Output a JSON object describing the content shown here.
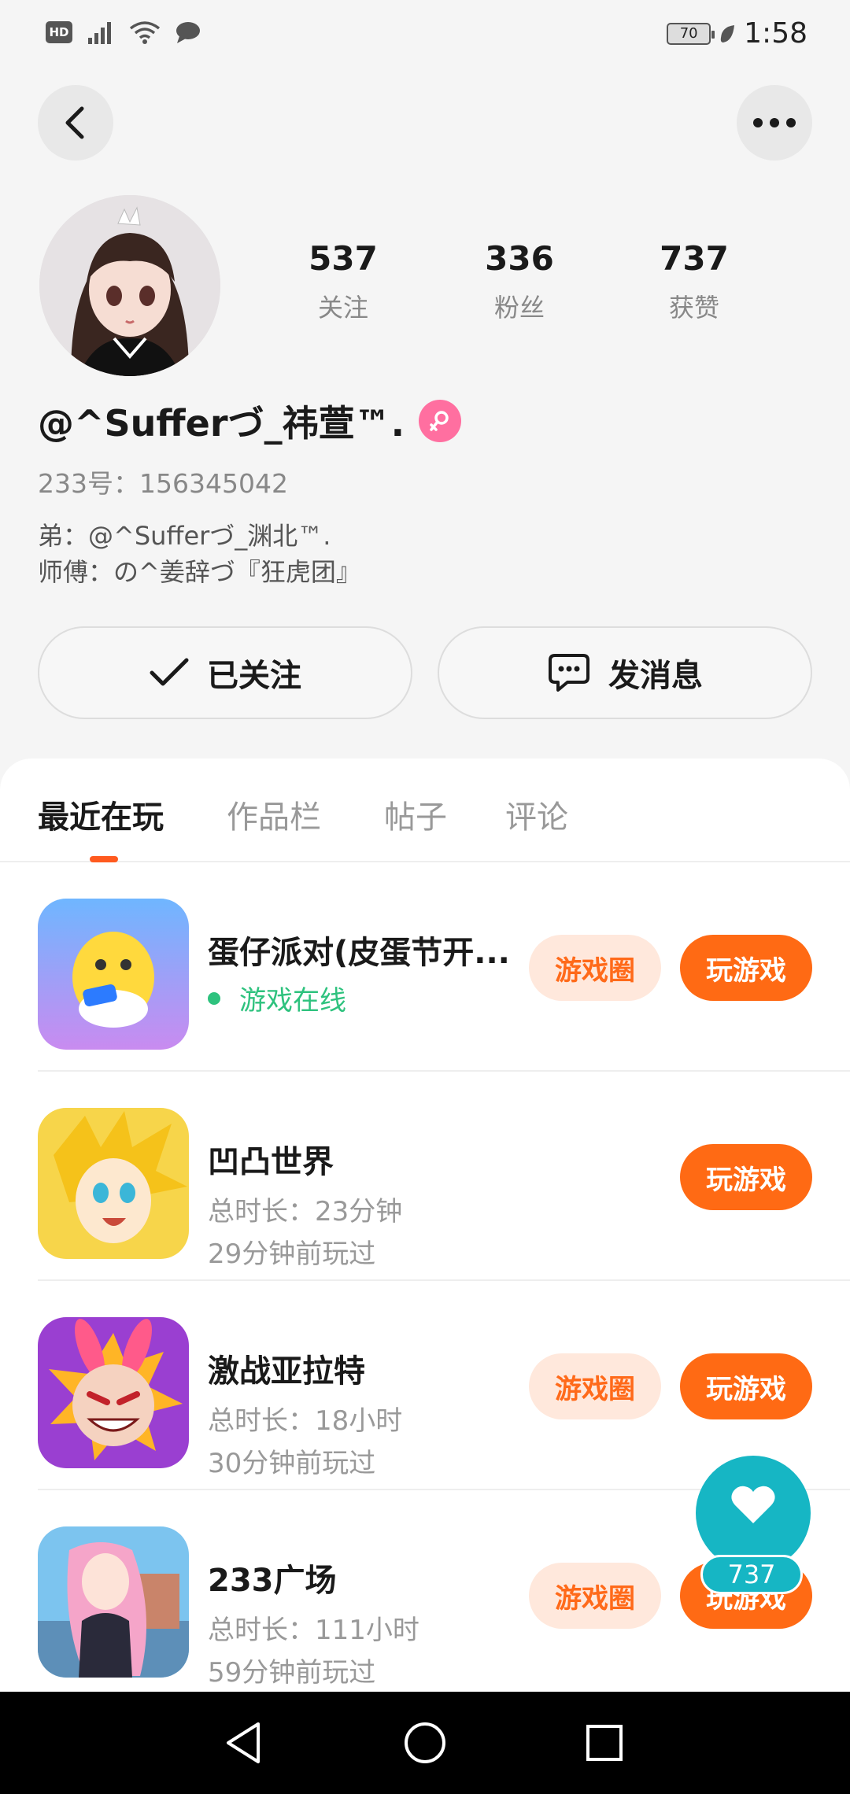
{
  "status_bar": {
    "time": "1:58",
    "battery": "70",
    "hd": "HD"
  },
  "profile": {
    "stats": [
      {
        "num": "537",
        "label": "关注"
      },
      {
        "num": "336",
        "label": "粉丝"
      },
      {
        "num": "737",
        "label": "获赞"
      }
    ],
    "username": "@^Sufferづ_祎萱™.",
    "uid": "233号：156345042",
    "relation_1": "弟：@^Sufferづ_渊北™.",
    "relation_2": "师傅：の^姜辞づ『狂虎团』",
    "follow_label": "已关注",
    "message_label": "发消息"
  },
  "tabs": [
    "最近在玩",
    "作品栏",
    "帖子",
    "评论"
  ],
  "games": [
    {
      "title": "蛋仔派对(皮蛋节开...",
      "status": "游戏在线",
      "circle": "游戏圈",
      "play": "玩游戏"
    },
    {
      "title": "凹凸世界",
      "duration": "总时长：23分钟",
      "last": "29分钟前玩过",
      "play": "玩游戏"
    },
    {
      "title": "激战亚拉特",
      "duration": "总时长：18小时",
      "last": "30分钟前玩过",
      "circle": "游戏圈",
      "play": "玩游戏"
    },
    {
      "title": "233广场",
      "duration": "总时长：111小时",
      "last": "59分钟前玩过",
      "circle": "游戏圈",
      "play": "玩游戏"
    }
  ],
  "float_like": {
    "count": "737"
  },
  "colors": {
    "accent": "#ff6a14",
    "online": "#2ec27e",
    "like": "#16b6c4"
  }
}
